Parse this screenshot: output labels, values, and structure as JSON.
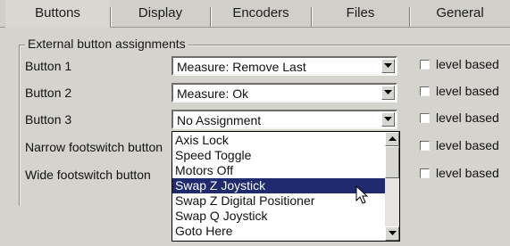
{
  "tabs": [
    "Buttons",
    "Display",
    "Encoders",
    "Files",
    "General"
  ],
  "group": {
    "title": "External button assignments"
  },
  "rows": [
    {
      "label": "Button 1",
      "value": "Measure: Remove Last",
      "checkbox_label": "level based"
    },
    {
      "label": "Button 2",
      "value": "Measure: Ok",
      "checkbox_label": "level based"
    },
    {
      "label": "Button 3",
      "value": "No Assignment",
      "checkbox_label": "level based"
    },
    {
      "label": "Narrow footswitch button",
      "checkbox_label": "level based"
    },
    {
      "label": "Wide footswitch button",
      "checkbox_label": "level based"
    }
  ],
  "dropdown": {
    "items": [
      "Axis Lock",
      "Speed Toggle",
      "Motors Off",
      "Swap Z Joystick",
      "Swap Z Digital Positioner",
      "Swap Q Joystick",
      "Goto Here"
    ],
    "highlighted": "Swap Z Joystick"
  },
  "icons": {
    "combo_arrow": "chevron-down-icon",
    "scroll_up": "arrow-up-icon",
    "scroll_down": "arrow-down-icon",
    "pointer": "mouse-pointer-icon"
  },
  "colors": {
    "selection": "#1f2b6e"
  }
}
